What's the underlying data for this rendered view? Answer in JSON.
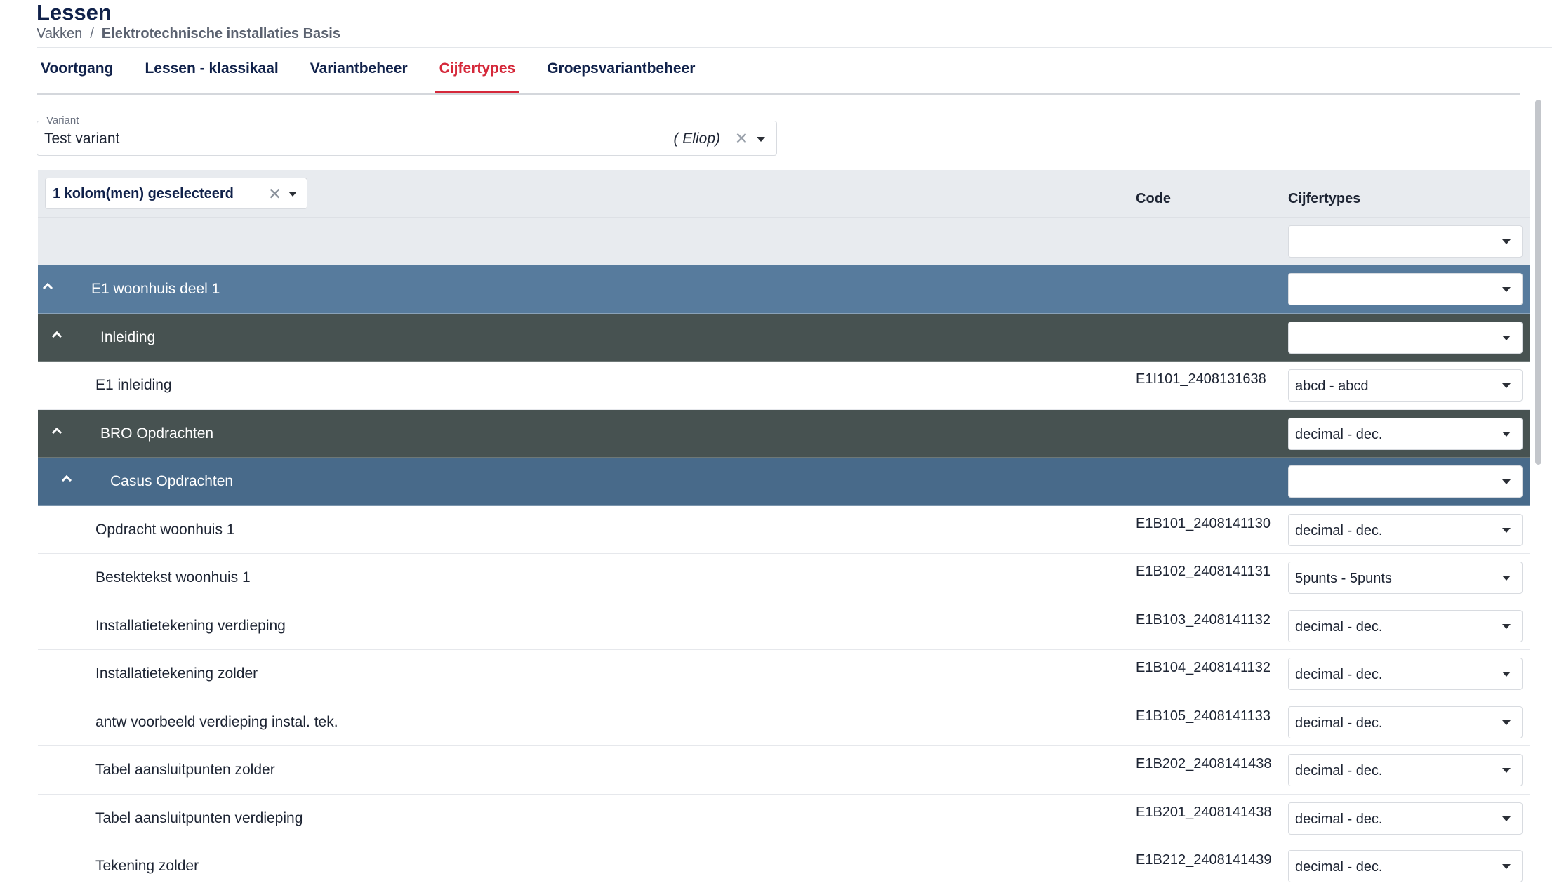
{
  "header": {
    "title": "Lessen",
    "breadcrumb": {
      "parent": "Vakken",
      "separator": "/",
      "current": "Elektrotechnische installaties Basis"
    }
  },
  "tabs": [
    {
      "label": "Voortgang",
      "active": false
    },
    {
      "label": "Lessen - klassikaal",
      "active": false
    },
    {
      "label": "Variantbeheer",
      "active": false
    },
    {
      "label": "Cijfertypes",
      "active": true
    },
    {
      "label": "Groepsvariantbeheer",
      "active": false
    }
  ],
  "variant": {
    "label": "Variant",
    "value": "Test variant",
    "extra": "( Eliop)",
    "clear_icon": "close-icon",
    "caret_icon": "caret-down-icon"
  },
  "grid": {
    "column_selector": "1 kolom(men) geselecteerd",
    "headers": {
      "code": "Code",
      "types": "Cijfertypes"
    },
    "rows": [
      {
        "kind": "group",
        "level": 0,
        "name": "E1 woonhuis deel 1",
        "code": "",
        "type": ""
      },
      {
        "kind": "group",
        "level": 1,
        "name": "Inleiding",
        "code": "",
        "type": ""
      },
      {
        "kind": "leaf",
        "level": 1,
        "name": "E1 inleiding",
        "code": "E1I101_2408131638",
        "type": "abcd - abcd"
      },
      {
        "kind": "group",
        "level": 1,
        "name": "BRO Opdrachten",
        "code": "",
        "type": "decimal - dec."
      },
      {
        "kind": "group",
        "level": 2,
        "name": "Casus Opdrachten",
        "code": "",
        "type": ""
      },
      {
        "kind": "leaf",
        "level": 2,
        "name": "Opdracht woonhuis 1",
        "code": "E1B101_2408141130",
        "type": "decimal - dec."
      },
      {
        "kind": "leaf",
        "level": 2,
        "name": "Bestektekst woonhuis 1",
        "code": "E1B102_2408141131",
        "type": "5punts - 5punts"
      },
      {
        "kind": "leaf",
        "level": 2,
        "name": "Installatietekening verdieping",
        "code": "E1B103_2408141132",
        "type": "decimal - dec."
      },
      {
        "kind": "leaf",
        "level": 2,
        "name": "Installatietekening zolder",
        "code": "E1B104_2408141132",
        "type": "decimal - dec."
      },
      {
        "kind": "leaf",
        "level": 2,
        "name": "antw voorbeeld verdieping instal. tek.",
        "code": "E1B105_2408141133",
        "type": "decimal - dec."
      },
      {
        "kind": "leaf",
        "level": 2,
        "name": "Tabel aansluitpunten zolder",
        "code": "E1B202_2408141438",
        "type": "decimal - dec."
      },
      {
        "kind": "leaf",
        "level": 2,
        "name": "Tabel aansluitpunten verdieping",
        "code": "E1B201_2408141438",
        "type": "decimal - dec."
      },
      {
        "kind": "leaf",
        "level": 2,
        "name": "Tekening zolder",
        "code": "E1B212_2408141439",
        "type": "decimal - dec."
      }
    ]
  },
  "colors": {
    "accent": "#d5283a",
    "group_level0": "#577b9d",
    "group_level1": "#475251",
    "group_level2": "#486a8a"
  }
}
